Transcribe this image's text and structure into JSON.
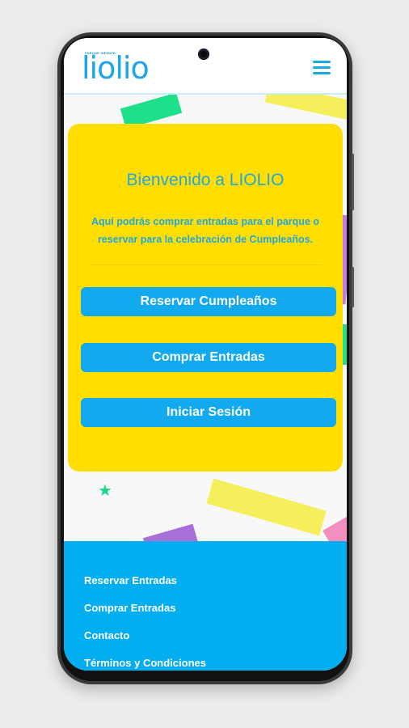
{
  "header": {
    "logo_tagline": "PARQUE INFANTIL",
    "logo": "liolio",
    "menu_icon": "hamburger-menu-icon"
  },
  "welcome": {
    "title": "Bienvenido a LIOLIO",
    "description": "Aquí podrás comprar entradas para el parque o reservar para la celebración de Cumpleaños."
  },
  "buttons": {
    "reserve_birthday": "Reservar Cumpleaños",
    "buy_tickets": "Comprar Entradas",
    "login": "Iniciar Sesión"
  },
  "footer": {
    "links": [
      "Reservar Entradas",
      "Comprar Entradas",
      "Contacto",
      "Términos y Condiciones"
    ]
  },
  "colors": {
    "brand_blue": "#12a9ef",
    "card_yellow": "#ffde00",
    "footer_blue": "#03aef0",
    "confetti_green": "#1ee08a",
    "confetti_purple": "#a86fd6",
    "confetti_yellow": "#f5ef5c",
    "confetti_pink": "#f28ec0"
  }
}
